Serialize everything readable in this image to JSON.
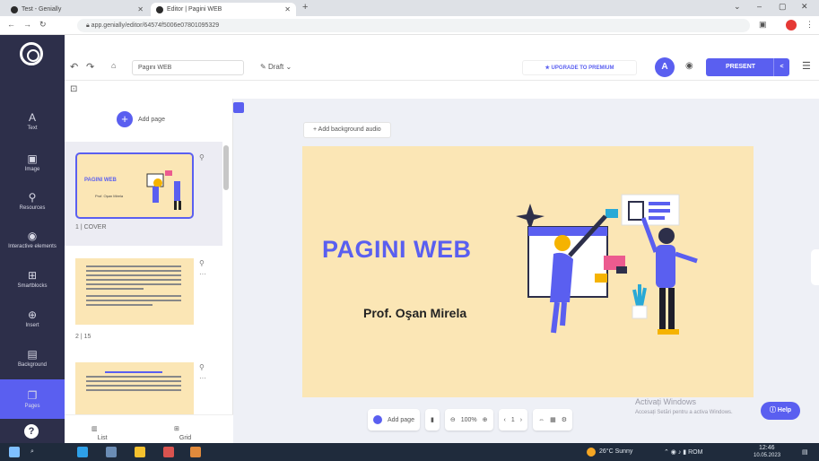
{
  "browser": {
    "tabs": [
      {
        "title": "Test - Genially"
      },
      {
        "title": "Editor | Pagini WEB"
      }
    ],
    "new_tab": "+",
    "url": "app.genially/editor/64574f5006e07801095329",
    "window_controls": [
      "⌄",
      "–",
      "▢",
      "✕"
    ]
  },
  "sidebar": {
    "items": [
      {
        "label": "Text",
        "icon": "A"
      },
      {
        "label": "Image",
        "icon": "▣"
      },
      {
        "label": "Resources",
        "icon": "⚲"
      },
      {
        "label": "Interactive elements",
        "icon": "◉"
      },
      {
        "label": "Smartblocks",
        "icon": "⊞"
      },
      {
        "label": "Insert",
        "icon": "⊕"
      },
      {
        "label": "Background",
        "icon": "▤"
      },
      {
        "label": "Pages",
        "icon": "❐"
      }
    ],
    "help_icon": "?"
  },
  "toolbar": {
    "title_value": "Pagini WEB",
    "draft_label": "Draft",
    "premium_label": "★ UPGRADE TO PREMIUM",
    "avatar_initial": "A",
    "present_label": "PRESENT"
  },
  "pages_panel": {
    "add_page_label": "Add page",
    "thumb1_title": "PAGINI WEB",
    "thumb1_subtitle": "Prof. Oşan Mirela",
    "pages": [
      {
        "label": "1 | COVER"
      },
      {
        "label": "2 | 15"
      }
    ],
    "list_label": "List",
    "grid_label": "Grid"
  },
  "canvas": {
    "add_background_audio": "+  Add background audio",
    "slide_title": "PAGINI WEB",
    "slide_author": "Prof. Oşan Mirela",
    "bottom": {
      "add_page": "Add page",
      "zoom": "100%",
      "page_number": "1"
    },
    "watermark_title": "Activați Windows",
    "watermark_sub": "Accesați Setări pentru a activa Windows.",
    "help_label": "Help"
  },
  "taskbar": {
    "weather": "26°C Sunny",
    "time": "12:46",
    "date": "10.05.2023"
  },
  "colors": {
    "accent": "#5a5ff0",
    "sidebar": "#2d2f4a",
    "slide_bg": "#fbe6b5"
  }
}
